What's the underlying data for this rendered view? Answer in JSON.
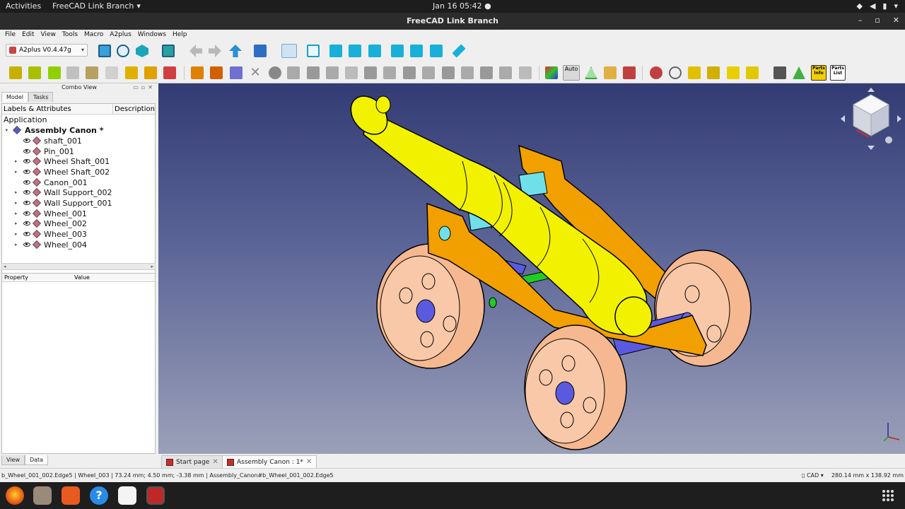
{
  "topbar": {
    "activities": "Activities",
    "app_name": "FreeCAD Link Branch",
    "clock": "Jan 16  05:42"
  },
  "window": {
    "title": "FreeCAD Link Branch"
  },
  "menu": [
    "File",
    "Edit",
    "View",
    "Tools",
    "Macro",
    "A2plus",
    "Windows",
    "Help"
  ],
  "workbench_selector": {
    "value": "A2plus V0.4.47g"
  },
  "toolbar": {
    "auto_label": "Auto",
    "parts_info_label": "Parts Info",
    "parts_list_label": "Parts List"
  },
  "combo_view": {
    "title": "Combo View",
    "tabs": [
      "Model",
      "Tasks"
    ],
    "tree_header": {
      "col1": "Labels & Attributes",
      "col2": "Description"
    },
    "tree": {
      "root": "Application",
      "document": "Assembly Canon *",
      "items": [
        {
          "label": "shaft_001",
          "expandable": false
        },
        {
          "label": "Pin_001",
          "expandable": false
        },
        {
          "label": "Wheel Shaft_001",
          "expandable": true
        },
        {
          "label": "Wheel Shaft_002",
          "expandable": true
        },
        {
          "label": "Canon_001",
          "expandable": false
        },
        {
          "label": "Wall Support_002",
          "expandable": true
        },
        {
          "label": "Wall Support_001",
          "expandable": true
        },
        {
          "label": "Wheel_001",
          "expandable": true
        },
        {
          "label": "Wheel_002",
          "expandable": true
        },
        {
          "label": "Wheel_003",
          "expandable": true
        },
        {
          "label": "Wheel_004",
          "expandable": true
        }
      ]
    },
    "property_header": {
      "col1": "Property",
      "col2": "Value"
    },
    "bottom_tabs": [
      "View",
      "Data"
    ]
  },
  "doc_tabs": [
    {
      "label": "Start page",
      "active": false
    },
    {
      "label": "Assembly Canon : 1*",
      "active": true
    }
  ],
  "status": {
    "left": "b_Wheel_001_002.Edge5 | Wheel_003 | 73.24 mm; 4.50 mm; -3.38 mm | Assembly_Canon#b_Wheel_001_002.Edge5",
    "nav_style": "CAD",
    "dimensions": "280.14 mm x 138.92 mm"
  },
  "colors": {
    "barrel": "#f2f200",
    "frame": "#f2a000",
    "wheel": "#f5b890",
    "axle": "#5a5ae0",
    "shaft": "#70e0e8",
    "pin": "#22cc22"
  }
}
